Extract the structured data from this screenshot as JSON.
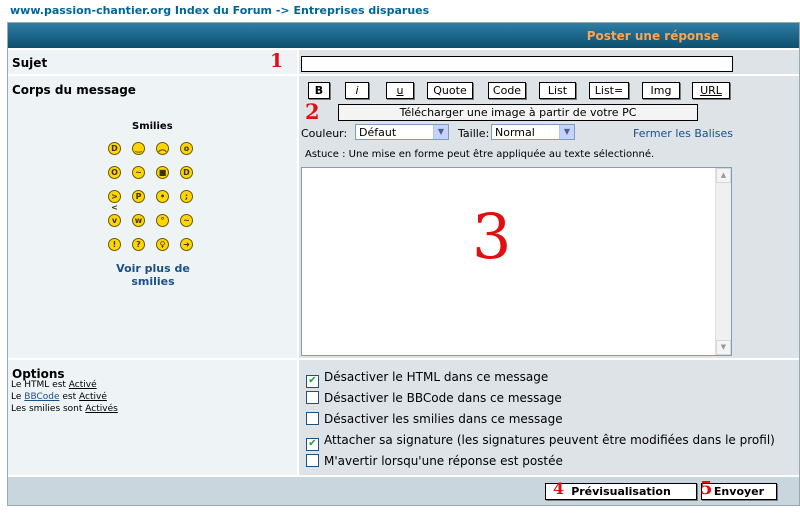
{
  "breadcrumb": {
    "site": "www.passion-chantier.org",
    "forum_index": "Index du Forum",
    "separator": "->",
    "current": "Entreprises disparues"
  },
  "header": {
    "title": "Poster une réponse"
  },
  "subject": {
    "label": "Sujet",
    "value": ""
  },
  "body": {
    "label": "Corps du message"
  },
  "annotations": {
    "one": "1",
    "two": "2",
    "three": "3",
    "four": "4",
    "five": "5"
  },
  "bbcode": {
    "buttons": [
      "B",
      "i",
      "u",
      "Quote",
      "Code",
      "List",
      "List=",
      "Img",
      "URL"
    ],
    "upload_label": "Télécharger une image à partir de votre PC",
    "color_label": "Couleur:",
    "color_value": "Défaut",
    "size_label": "Taille:",
    "size_value": "Normal",
    "close_tags": "Fermer les Balises",
    "tip": "Astuce : Une mise en forme peut être appliquée au texte sélectionné."
  },
  "smilies": {
    "title": "Smilies",
    "more_line1": "Voir plus de",
    "more_line2": "smilies",
    "faces": [
      "grin",
      "smile",
      "sad",
      "surprised",
      "shocked",
      "confused",
      "cool",
      "laughing",
      "mad",
      "razz",
      "embarrassed",
      "crying",
      "evil",
      "twisted",
      "rolleyes",
      "wink",
      "exclaim",
      "question",
      "idea",
      "arrow"
    ]
  },
  "options": {
    "title": "Options",
    "html_prefix": "Le HTML est",
    "html_state": "Activé",
    "bbcode_prefix": "Le",
    "bbcode_link": "BBCode",
    "bbcode_mid": "est",
    "bbcode_state": "Activé",
    "smilies_prefix": "Les smilies sont",
    "smilies_state": "Activés",
    "checkboxes": [
      {
        "label": "Désactiver le HTML dans ce message",
        "checked": true
      },
      {
        "label": "Désactiver le BBCode dans ce message",
        "checked": false
      },
      {
        "label": "Désactiver les smilies dans ce message",
        "checked": false
      },
      {
        "label": "Attacher sa signature (les signatures peuvent être modifiées dans le profil)",
        "checked": true
      },
      {
        "label": "M'avertir lorsqu'une réponse est postée",
        "checked": false
      }
    ]
  },
  "footer": {
    "preview_label": "Prévisualisation",
    "submit_label": "Envoyer"
  }
}
